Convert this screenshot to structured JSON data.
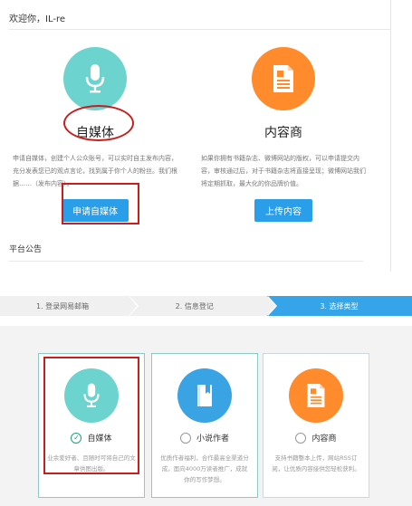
{
  "header": {
    "welcome": "欢迎你，IL-re"
  },
  "cards_top": [
    {
      "title": "自媒体",
      "icon": "microphone-icon",
      "color": "#6dd3cf",
      "desc": "申请自媒体，创建个人公众账号，可以实时自主发布内容，充分发表您已的观点言论，找到属于你个人的粉丝。我们根据……（发布内容）。",
      "button": "申请自媒体"
    },
    {
      "title": "内容商",
      "icon": "document-icon",
      "color": "#ff8b2c",
      "desc": "如果你拥有书籍杂志、微博网站的版权，可以申请提交内容，审核通过后，对于书籍杂志将直接呈现；微博网站我们将定期抓取，最大化的你品牌价值。",
      "button": "上传内容"
    }
  ],
  "platform_notice": "平台公告",
  "steps": [
    {
      "label": "1. 登录网易邮箱",
      "active": false
    },
    {
      "label": "2. 信息登记",
      "active": false
    },
    {
      "label": "3. 选择类型",
      "active": true
    }
  ],
  "cards_bottom": [
    {
      "label": "自媒体",
      "icon": "microphone-icon",
      "color": "#6dd3cf",
      "selected": true,
      "desc": "业余爱好者、且随时可将自己的文章供图出版。"
    },
    {
      "label": "小说作者",
      "icon": "book-icon",
      "color": "#3aa3e3",
      "selected": false,
      "desc": "优质作者福利，合作最高全渠道分成，面向4000万读者推广，成就你的写作梦想。"
    },
    {
      "label": "内容商",
      "icon": "document-icon",
      "color": "#ff8b2c",
      "selected": false,
      "desc": "支持书籍整本上传，网站RSS订阅，让优质内容接供您轻松获利。"
    }
  ],
  "annotation_color": "#c81e1e"
}
